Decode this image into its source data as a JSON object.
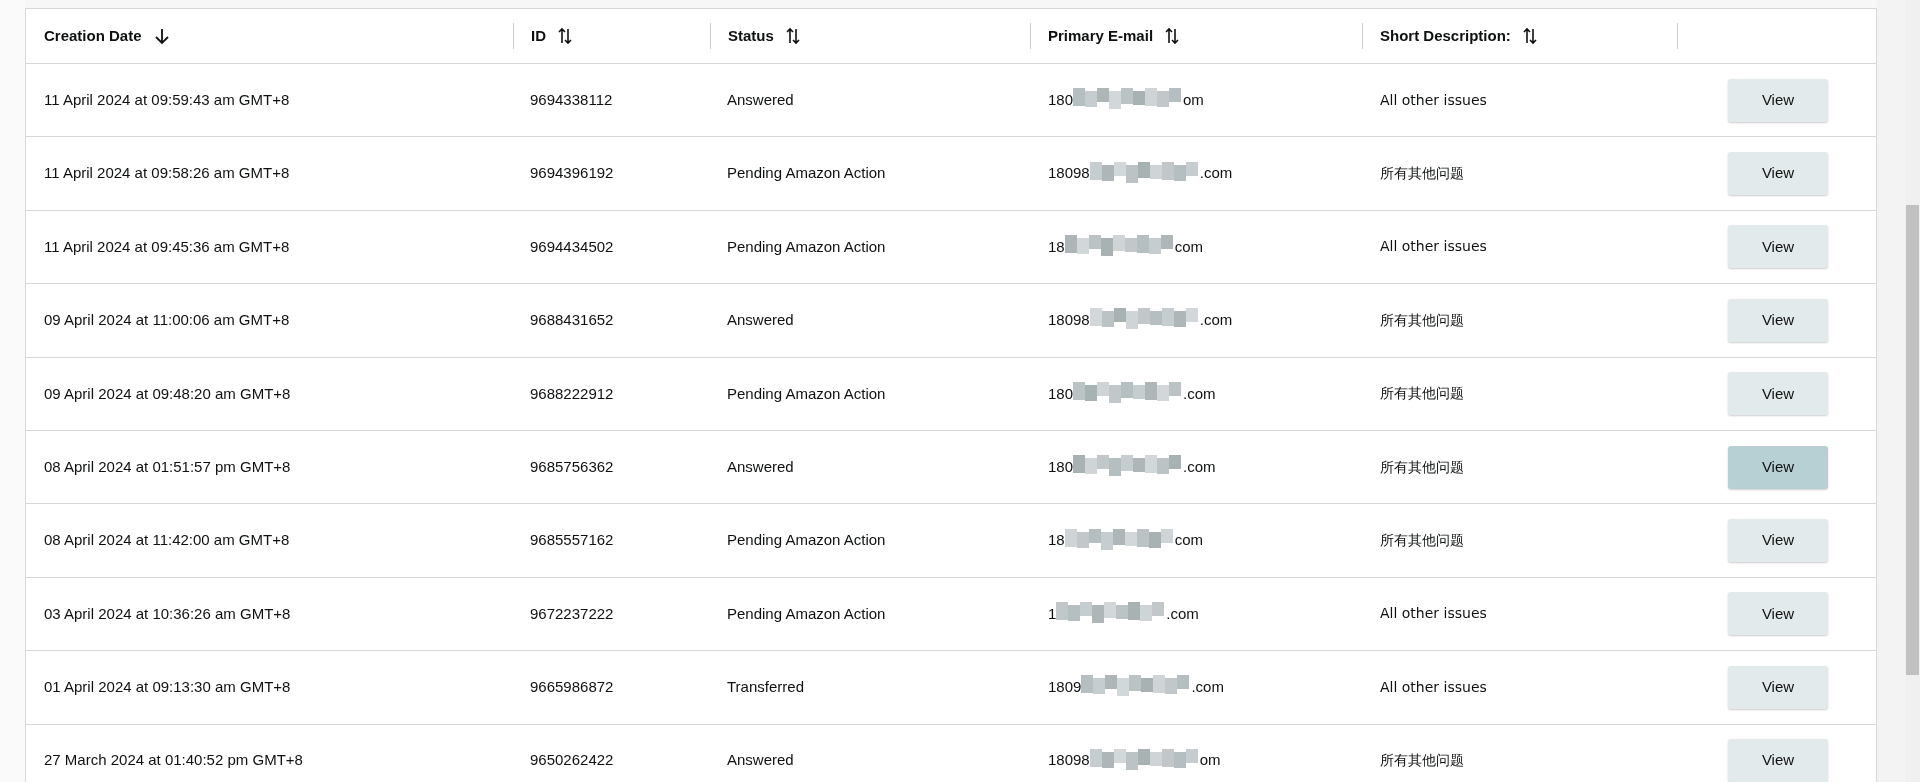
{
  "table": {
    "columns": [
      {
        "label": "Creation Date",
        "sorted": true
      },
      {
        "label": "ID",
        "sorted": false
      },
      {
        "label": "Status",
        "sorted": false
      },
      {
        "label": "Primary E-mail",
        "sorted": false
      },
      {
        "label": "Short Description:",
        "sorted": false
      },
      {}
    ],
    "rows": [
      {
        "date": "11 April 2024 at 09:59:43 am GMT+8",
        "id": "9694338112",
        "status": "Answered",
        "email_start": "180",
        "email_end": "om",
        "description": "All other issues",
        "action": "View",
        "highlighted": false
      },
      {
        "date": "11 April 2024 at 09:58:26 am GMT+8",
        "id": "9694396192",
        "status": "Pending Amazon Action",
        "email_start": "18098",
        "email_end": ".com",
        "description": "所有其他问题",
        "action": "View",
        "highlighted": false
      },
      {
        "date": "11 April 2024 at 09:45:36 am GMT+8",
        "id": "9694434502",
        "status": "Pending Amazon Action",
        "email_start": "18",
        "email_end": "com",
        "description": "All other issues",
        "action": "View",
        "highlighted": false
      },
      {
        "date": "09 April 2024 at 11:00:06 am GMT+8",
        "id": "9688431652",
        "status": "Answered",
        "email_start": "18098",
        "email_end": ".com",
        "description": "所有其他问题",
        "action": "View",
        "highlighted": false
      },
      {
        "date": "09 April 2024 at 09:48:20 am GMT+8",
        "id": "9688222912",
        "status": "Pending Amazon Action",
        "email_start": "180",
        "email_end": ".com",
        "description": "所有其他问题",
        "action": "View",
        "highlighted": false
      },
      {
        "date": "08 April 2024 at 01:51:57 pm GMT+8",
        "id": "9685756362",
        "status": "Answered",
        "email_start": "180",
        "email_end": ".com",
        "description": "所有其他问题",
        "action": "View",
        "highlighted": true
      },
      {
        "date": "08 April 2024 at 11:42:00 am GMT+8",
        "id": "9685557162",
        "status": "Pending Amazon Action",
        "email_start": "18",
        "email_end": "com",
        "description": "所有其他问题",
        "action": "View",
        "highlighted": false
      },
      {
        "date": "03 April 2024 at 10:36:26 am GMT+8",
        "id": "9672237222",
        "status": "Pending Amazon Action",
        "email_start": "1",
        "email_end": ".com",
        "description": "All other issues",
        "action": "View",
        "highlighted": false
      },
      {
        "date": "01 April 2024 at 09:13:30 am GMT+8",
        "id": "9665986872",
        "status": "Transferred",
        "email_start": "1809",
        "email_end": ".com",
        "description": "All other issues",
        "action": "View",
        "highlighted": false
      },
      {
        "date": "27 March 2024 at 01:40:52 pm GMT+8",
        "id": "9650262422",
        "status": "Answered",
        "email_start": "18098",
        "email_end": "om",
        "description": "所有其他问题",
        "action": "View",
        "highlighted": false
      }
    ]
  }
}
